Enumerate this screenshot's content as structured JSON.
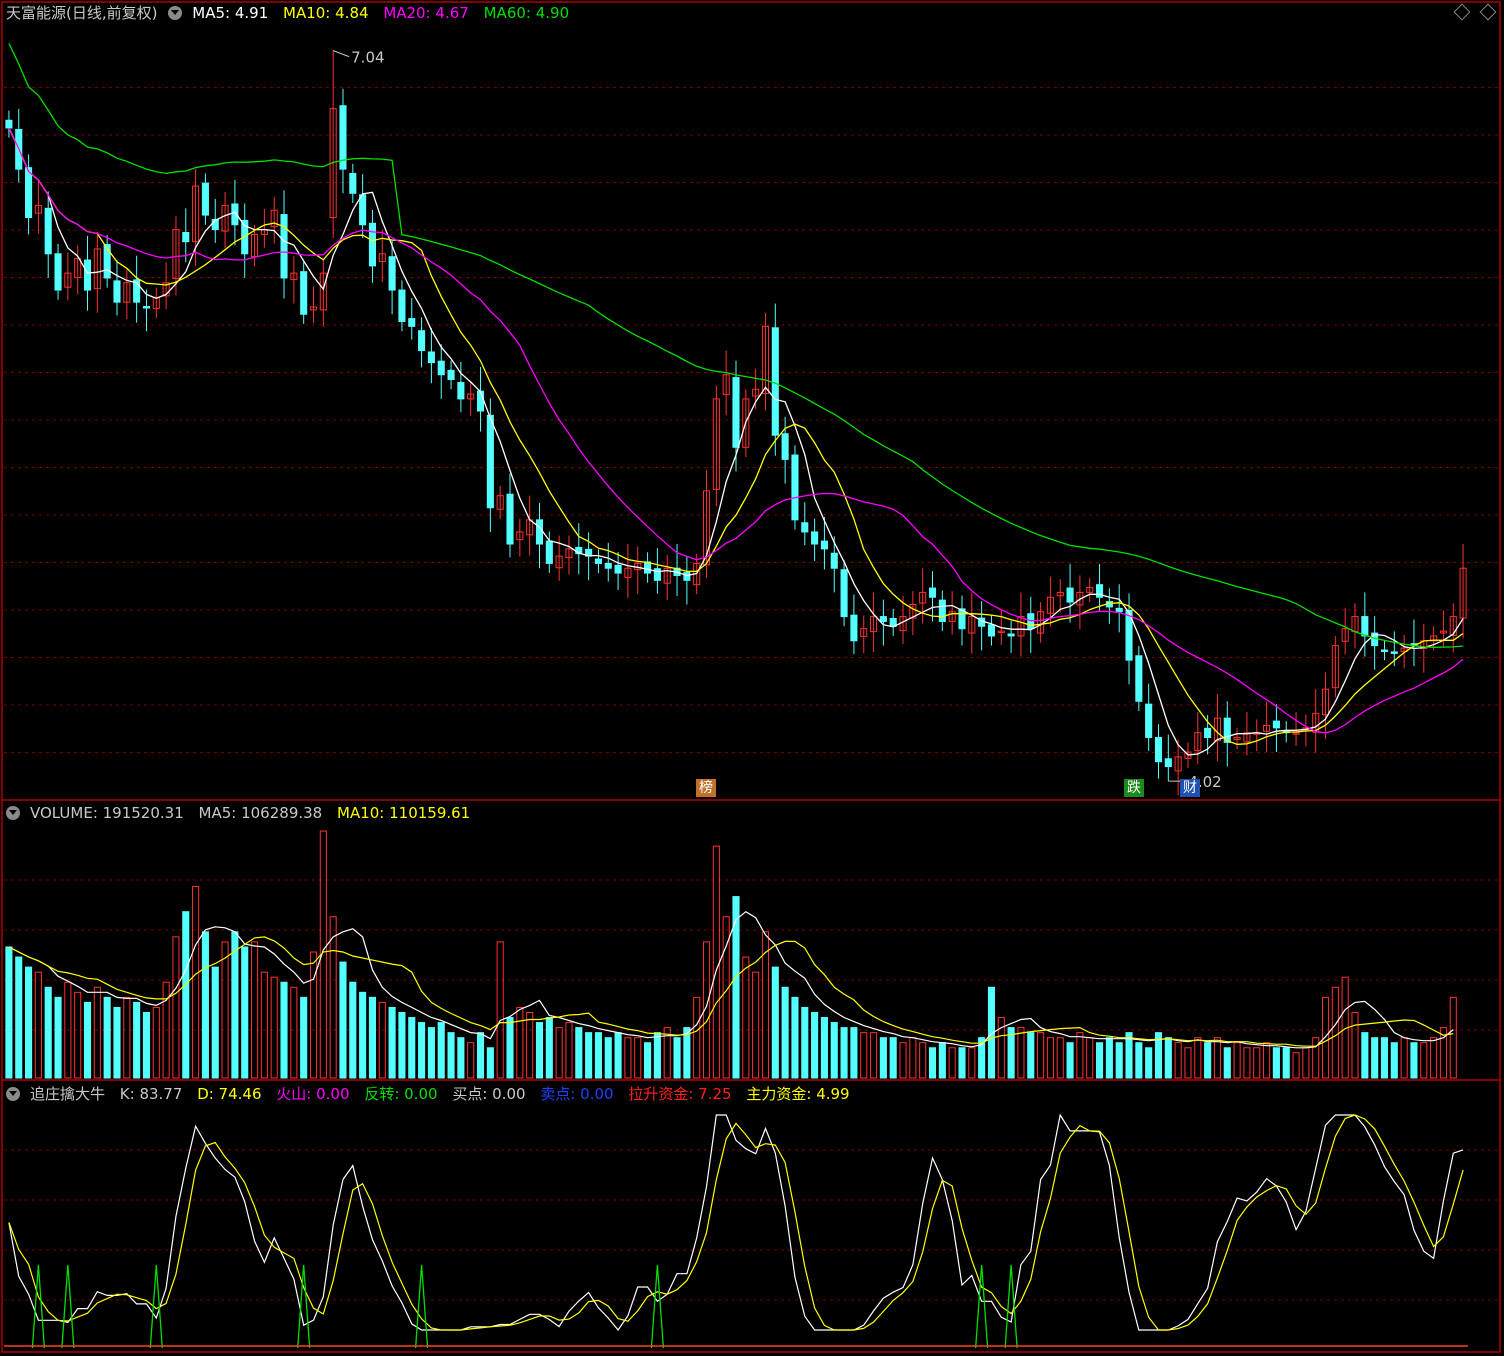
{
  "main": {
    "title": "天富能源(日线,前复权)",
    "ma5": "MA5: 4.91",
    "ma10": "MA10: 4.84",
    "ma20": "MA20: 4.67",
    "ma60": "MA60: 4.90",
    "high_label": "7.04",
    "low_label": "4.02",
    "badges": [
      "榜",
      "跌",
      "财"
    ]
  },
  "volume": {
    "vol": "VOLUME: 191520.31",
    "ma5": "MA5: 106289.38",
    "ma10": "MA10: 110159.61"
  },
  "indicator": {
    "name": "追庄擒大牛",
    "k": "K: 83.77",
    "d": "D: 74.46",
    "huoshan": "火山: 0.00",
    "fanzhuan": "反转: 0.00",
    "maidian": "买点: 0.00",
    "maidian2": "卖点: 0.00",
    "lasheng": "拉升资金: 7.25",
    "zhuli": "主力资金: 4.99"
  },
  "colors": {
    "up": "#ff3030",
    "down": "#54ffff",
    "ma5": "#ffffff",
    "ma10": "#ffff00",
    "ma20": "#ff00ff",
    "ma60": "#00e000",
    "grid": "#7a0000",
    "panel_border": "#b00000"
  },
  "chart_data": {
    "type": "candlestick",
    "price_extremes": {
      "high": 7.04,
      "low": 4.02
    },
    "closes": [
      6.72,
      6.55,
      6.35,
      6.4,
      6.2,
      6.05,
      6.12,
      6.18,
      6.05,
      6.22,
      6.1,
      6.0,
      6.08,
      6.0,
      5.98,
      6.02,
      6.08,
      6.3,
      6.25,
      6.48,
      6.36,
      6.3,
      6.4,
      6.32,
      6.2,
      6.28,
      6.3,
      6.38,
      6.1,
      6.12,
      5.95,
      5.98,
      6.12,
      6.8,
      6.55,
      6.45,
      6.32,
      6.15,
      6.2,
      6.05,
      5.92,
      5.9,
      5.8,
      5.75,
      5.7,
      5.68,
      5.6,
      5.62,
      5.55,
      5.15,
      5.2,
      5.0,
      5.05,
      5.1,
      5.0,
      4.92,
      4.95,
      4.98,
      4.96,
      4.95,
      4.92,
      4.9,
      4.88,
      4.9,
      4.92,
      4.88,
      4.85,
      4.9,
      4.87,
      4.85,
      4.92,
      5.22,
      5.6,
      5.7,
      5.4,
      5.6,
      5.64,
      5.9,
      5.45,
      5.35,
      5.1,
      5.05,
      5.0,
      4.98,
      4.9,
      4.7,
      4.6,
      4.65,
      4.7,
      4.68,
      4.66,
      4.7,
      4.75,
      4.8,
      4.78,
      4.68,
      4.72,
      4.65,
      4.7,
      4.66,
      4.62,
      4.64,
      4.62,
      4.7,
      4.65,
      4.72,
      4.78,
      4.8,
      4.76,
      4.8,
      4.82,
      4.78,
      4.74,
      4.72,
      4.52,
      4.35,
      4.2,
      4.1,
      4.08,
      4.12,
      4.14,
      4.22,
      4.2,
      4.28,
      4.18,
      4.2,
      4.22,
      4.22,
      4.25,
      4.24,
      4.22,
      4.22,
      4.24,
      4.3,
      4.4,
      4.58,
      4.65,
      4.7,
      4.62,
      4.58,
      4.56,
      4.55,
      4.57,
      4.58,
      4.6,
      4.62,
      4.64,
      4.7,
      4.9
    ],
    "volume": [
      2.6,
      2.4,
      2.2,
      2.1,
      1.8,
      1.6,
      1.9,
      1.7,
      1.5,
      1.8,
      1.6,
      1.4,
      1.6,
      1.5,
      1.3,
      1.4,
      1.9,
      2.8,
      3.3,
      3.8,
      2.9,
      2.2,
      2.7,
      2.9,
      2.6,
      2.7,
      2.1,
      2.0,
      1.9,
      1.8,
      1.6,
      2.5,
      4.9,
      3.2,
      2.3,
      1.9,
      1.7,
      1.6,
      1.5,
      1.4,
      1.3,
      1.2,
      1.1,
      1.0,
      1.1,
      0.9,
      0.8,
      0.7,
      0.9,
      0.6,
      2.7,
      1.2,
      1.4,
      1.3,
      1.1,
      1.2,
      1.0,
      1.1,
      1.0,
      0.9,
      0.9,
      0.8,
      0.9,
      0.8,
      0.8,
      0.7,
      0.9,
      1.0,
      0.8,
      1.0,
      1.6,
      2.7,
      4.6,
      3.2,
      3.6,
      2.4,
      2.1,
      2.9,
      2.2,
      1.8,
      1.6,
      1.4,
      1.3,
      1.2,
      1.1,
      1.0,
      1.0,
      0.9,
      0.9,
      0.8,
      0.8,
      0.7,
      0.8,
      0.7,
      0.6,
      0.7,
      0.6,
      0.6,
      0.6,
      0.8,
      1.8,
      1.2,
      1.0,
      1.0,
      0.9,
      0.9,
      0.8,
      0.8,
      0.7,
      0.9,
      0.8,
      0.7,
      0.8,
      0.7,
      0.9,
      0.7,
      0.6,
      0.9,
      0.8,
      0.7,
      0.6,
      0.8,
      0.7,
      0.8,
      0.6,
      0.7,
      0.6,
      0.6,
      0.7,
      0.6,
      0.6,
      0.5,
      0.6,
      0.8,
      1.6,
      1.8,
      2.0,
      1.3,
      0.9,
      0.8,
      0.8,
      0.7,
      0.8,
      0.7,
      0.7,
      0.8,
      1.0,
      1.6
    ],
    "indicator_k": [
      84,
      83.77
    ],
    "indicator_d": [
      74.46
    ]
  }
}
